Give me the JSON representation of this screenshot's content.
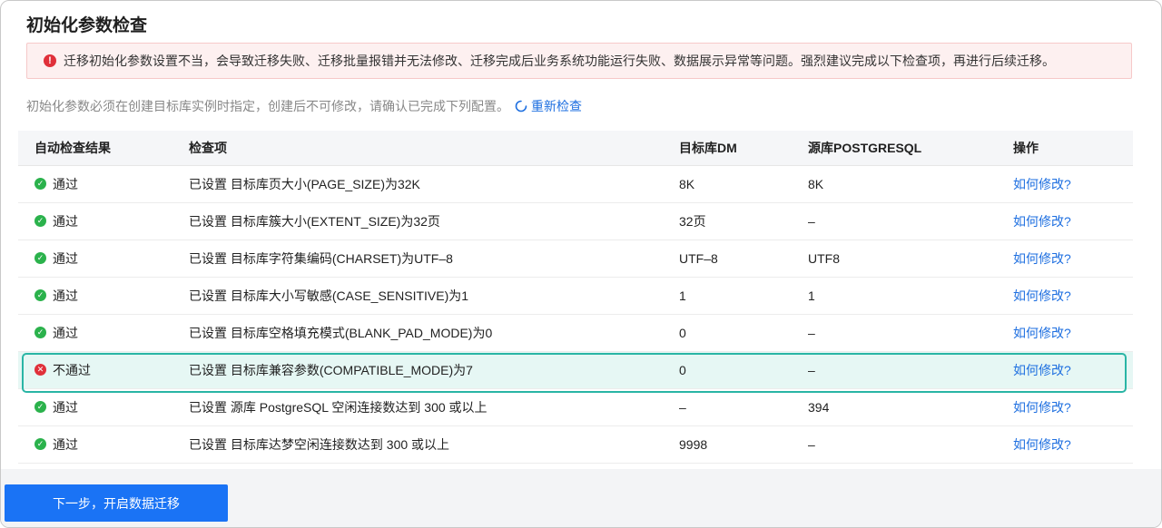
{
  "page": {
    "title": "初始化参数检查",
    "alert": "迁移初始化参数设置不当，会导致迁移失败、迁移批量报错并无法修改、迁移完成后业务系统功能运行失败、数据展示异常等问题。强烈建议完成以下检查项，再进行后续迁移。",
    "description": "初始化参数必须在创建目标库实例时指定，创建后不可修改，请确认已完成下列配置。",
    "recheck_label": "重新检查"
  },
  "table": {
    "headers": [
      "自动检查结果",
      "检查项",
      "目标库DM",
      "源库POSTGRESQL",
      "操作"
    ],
    "rows": [
      {
        "status": "通过",
        "passed": true,
        "item": "已设置 目标库页大小(PAGE_SIZE)为32K",
        "target": "8K",
        "source": "8K",
        "action": "如何修改?"
      },
      {
        "status": "通过",
        "passed": true,
        "item": "已设置 目标库簇大小(EXTENT_SIZE)为32页",
        "target": "32页",
        "source": "–",
        "action": "如何修改?"
      },
      {
        "status": "通过",
        "passed": true,
        "item": "已设置 目标库字符集编码(CHARSET)为UTF–8",
        "target": "UTF–8",
        "source": "UTF8",
        "action": "如何修改?"
      },
      {
        "status": "通过",
        "passed": true,
        "item": "已设置 目标库大小写敏感(CASE_SENSITIVE)为1",
        "target": "1",
        "source": "1",
        "action": "如何修改?"
      },
      {
        "status": "通过",
        "passed": true,
        "item": "已设置 目标库空格填充模式(BLANK_PAD_MODE)为0",
        "target": "0",
        "source": "–",
        "action": "如何修改?"
      },
      {
        "status": "不通过",
        "passed": false,
        "item": "已设置 目标库兼容参数(COMPATIBLE_MODE)为7",
        "target": "0",
        "source": "–",
        "action": "如何修改?"
      },
      {
        "status": "通过",
        "passed": true,
        "item": "已设置 源库 PostgreSQL 空闲连接数达到 300 或以上",
        "target": "–",
        "source": "394",
        "action": "如何修改?"
      },
      {
        "status": "通过",
        "passed": true,
        "item": "已设置 目标库达梦空闲连接数达到 300 或以上",
        "target": "9998",
        "source": "–",
        "action": "如何修改?"
      }
    ]
  },
  "footer": {
    "next_button": "下一步，开启数据迁移"
  },
  "colors": {
    "primary": "#1a73f5",
    "pass": "#2bb24c",
    "fail": "#e0303a",
    "highlight": "#2ab5a5"
  },
  "icons": {
    "pass": "check-circle-icon",
    "fail": "close-circle-icon",
    "alert": "exclamation-circle-icon",
    "recheck": "refresh-icon"
  }
}
